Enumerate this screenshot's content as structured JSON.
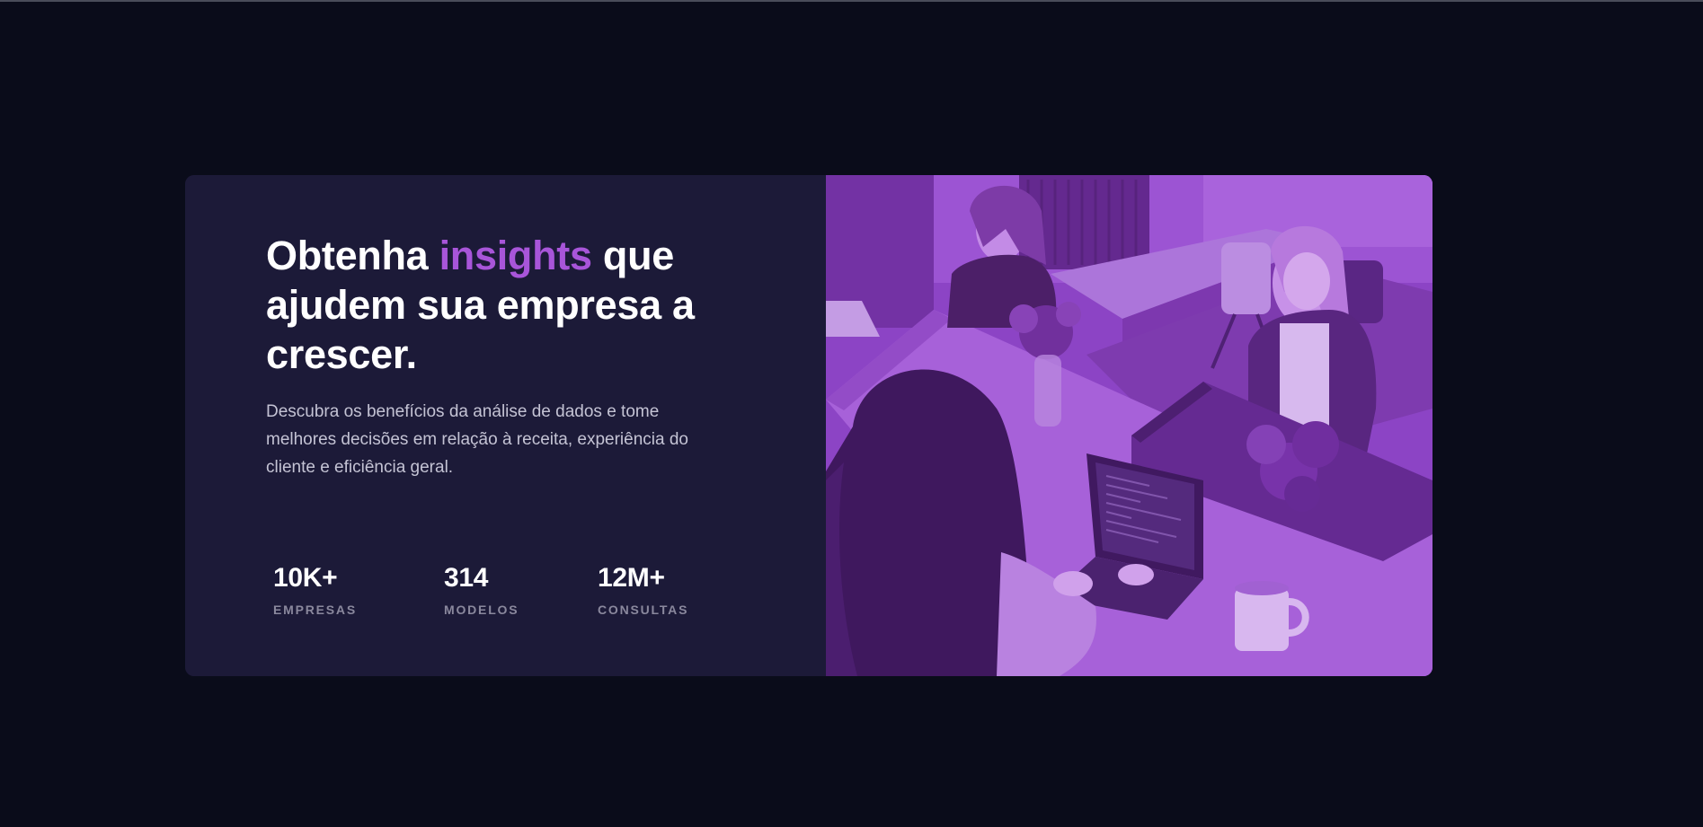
{
  "hero": {
    "headline_part1": "Obtenha ",
    "headline_accent": "insights",
    "headline_part2": " que ajudem sua empresa a crescer.",
    "description": "Descubra os benefícios da análise de dados e tome melhores decisões em relação à receita, experiência do cliente e eficiência geral.",
    "stats": [
      {
        "value": "10K+",
        "label": "EMPRESAS"
      },
      {
        "value": "314",
        "label": "MODELOS"
      },
      {
        "value": "12M+",
        "label": "CONSULTAS"
      }
    ],
    "image_alt": "office-photo",
    "colors": {
      "page_background": "#0a0c1a",
      "card_background": "#1c1a38",
      "accent": "#a855d9",
      "image_overlay": "#8d47c4"
    }
  }
}
